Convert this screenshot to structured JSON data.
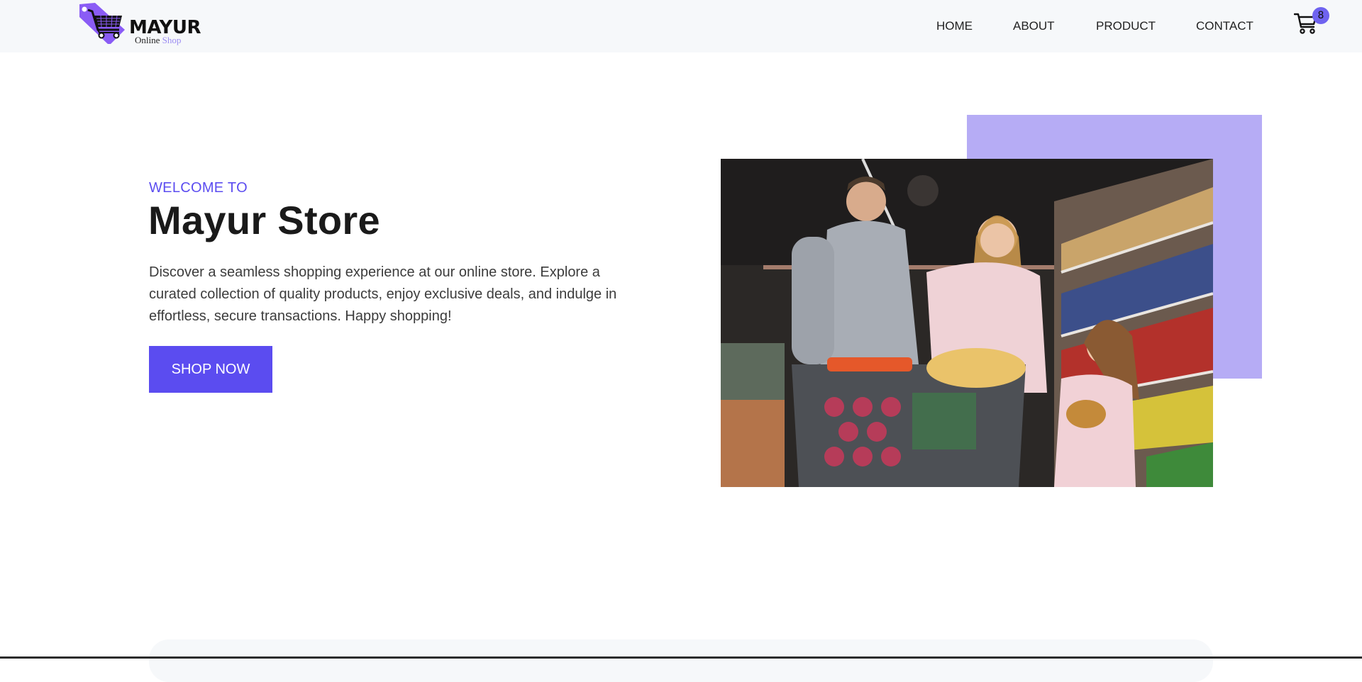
{
  "header": {
    "logo": {
      "name": "MAYUR",
      "sub_online": "Online",
      "sub_shop": "Shop",
      "icon": "shopping-cart-tag-icon"
    },
    "nav": {
      "home": "HOME",
      "about": "ABOUT",
      "product": "PRODUCT",
      "contact": "CONTACT"
    },
    "cart": {
      "icon": "cart-icon",
      "count": "8"
    }
  },
  "hero": {
    "welcome": "WELCOME TO",
    "title": "Mayur Store",
    "description": "Discover a seamless shopping experience at our online store. Explore a curated collection of quality products, enjoy exclusive deals, and indulge in effortless, secure transactions. Happy shopping!",
    "cta": "SHOP NOW",
    "image": "family-shopping-photo"
  },
  "colors": {
    "accent": "#5b4cf0",
    "accent_light": "#b6acf5",
    "header_bg": "#f6f8fa",
    "badge": "#6f63f0"
  }
}
